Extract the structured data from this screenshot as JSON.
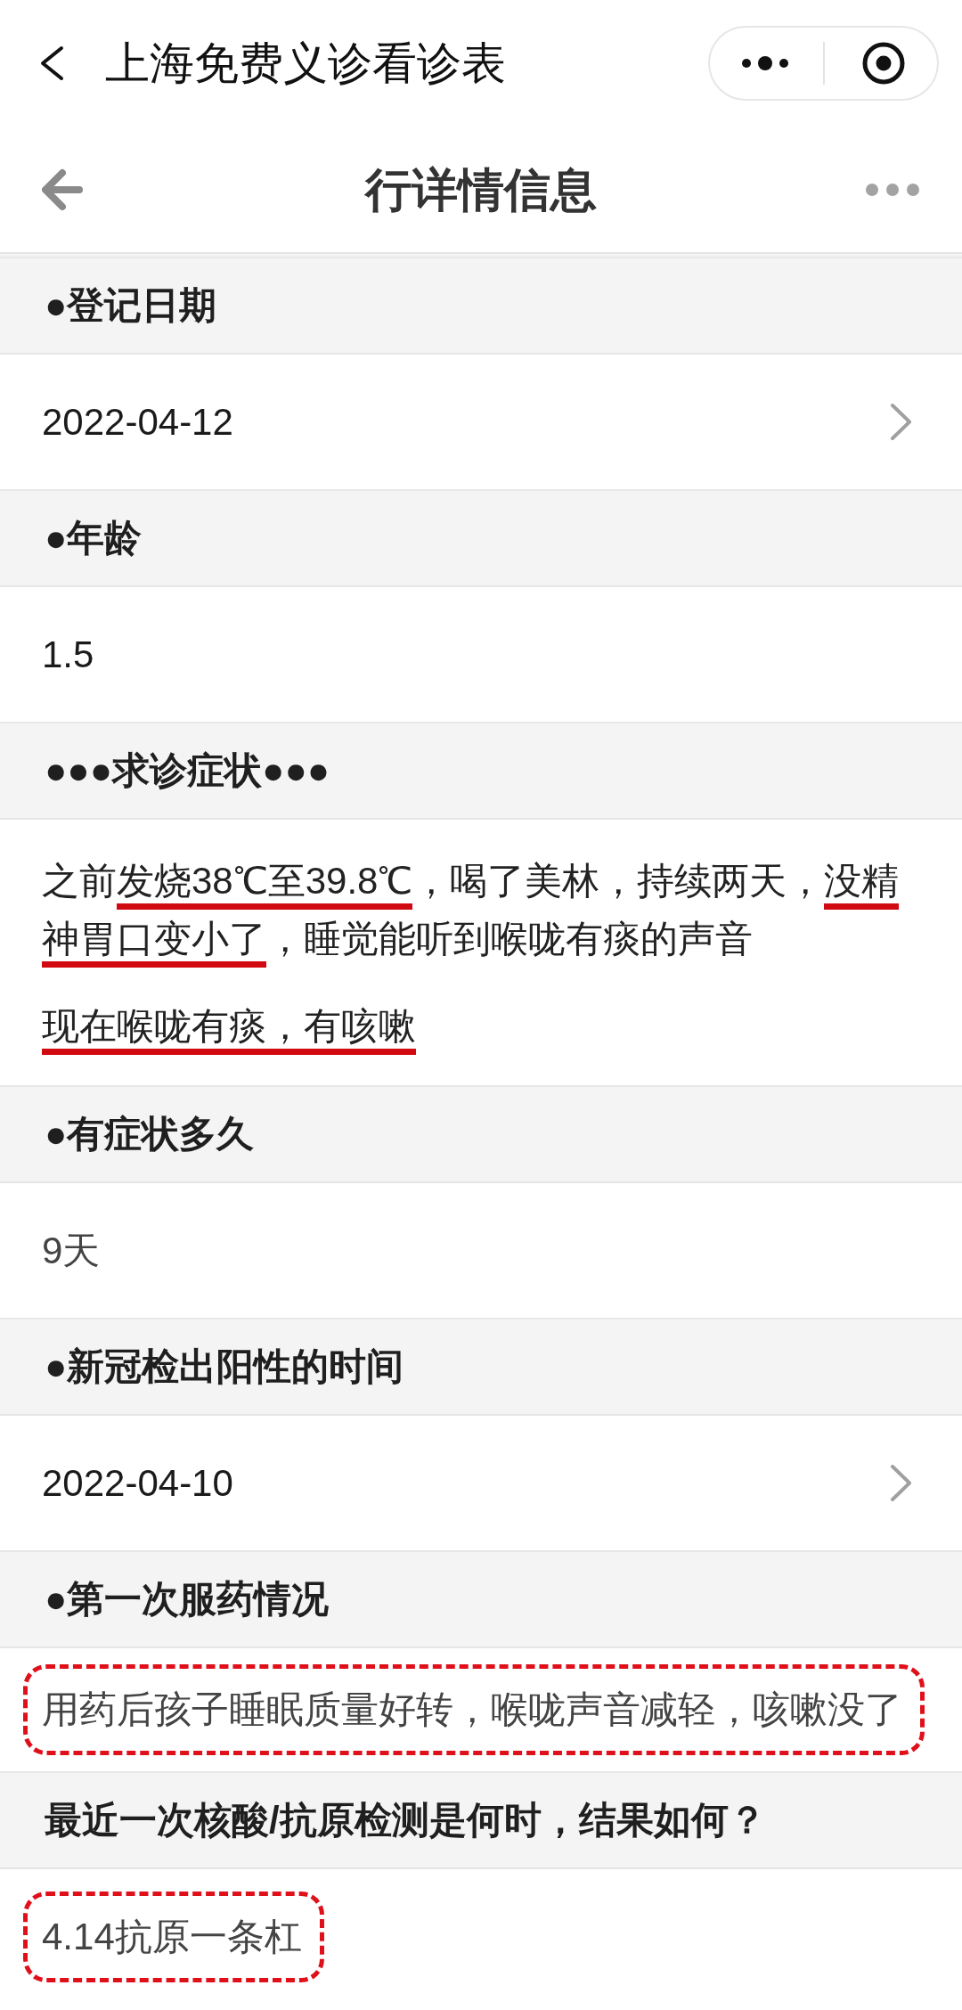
{
  "nav_bar": {
    "title": "上海免费义诊看诊表"
  },
  "page_header": {
    "title": "行详情信息"
  },
  "fields": [
    {
      "kind": "picker",
      "label": "●登记日期",
      "value": "2022-04-12",
      "boxed": false
    },
    {
      "kind": "input",
      "label": "●年龄",
      "value": "1.5",
      "boxed": false
    },
    {
      "kind": "paragraphs",
      "label": "●●●求诊症状●●●",
      "boxed": false,
      "paragraphs": [
        {
          "segments": [
            {
              "text": "之前",
              "underlined": false
            },
            {
              "text": "发烧38℃至39.8℃",
              "underlined": true
            },
            {
              "text": "，喝了美林，持续两天，",
              "underlined": false
            },
            {
              "text": "没精神胃口变小了",
              "underlined": true
            },
            {
              "text": "，睡觉能听到喉咙有痰的声音",
              "underlined": false
            }
          ]
        },
        {
          "segments": [
            {
              "text": "现在喉咙有痰，有咳嗽",
              "underlined": true
            }
          ]
        }
      ]
    },
    {
      "kind": "textarea",
      "label": "●有症状多久",
      "value": "9天",
      "boxed": false
    },
    {
      "kind": "picker",
      "label": "●新冠检出阳性的时间",
      "value": "2022-04-10",
      "boxed": false
    },
    {
      "kind": "textarea",
      "label": "●第一次服药情况",
      "value": "用药后孩子睡眠质量好转，喉咙声音减轻，咳嗽没了",
      "boxed": true
    },
    {
      "kind": "textarea",
      "label": "最近一次核酸/抗原检测是何时，结果如何？",
      "value": "4.14抗原一条杠",
      "boxed": true
    }
  ]
}
